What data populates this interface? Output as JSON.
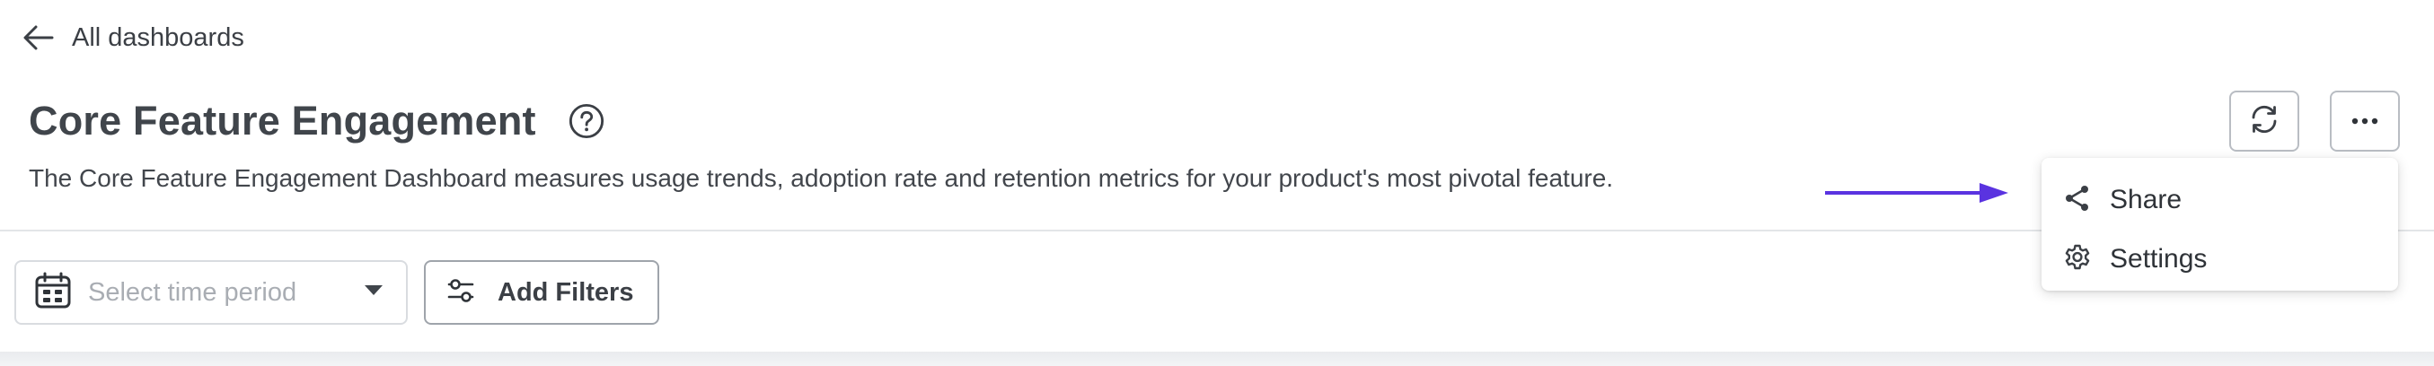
{
  "header": {
    "back_label": "All dashboards",
    "title": "Core Feature Engagement",
    "description": "The Core Feature Engagement Dashboard measures usage trends, adoption rate and retention metrics for your product's most pivotal feature."
  },
  "toolbar": {
    "refresh_icon": "refresh-icon",
    "more_icon": "more-horizontal-icon"
  },
  "more_menu": {
    "items": [
      {
        "label": "Share",
        "icon": "share-icon"
      },
      {
        "label": "Settings",
        "icon": "gear-icon"
      }
    ]
  },
  "filters": {
    "time_period_placeholder": "Select time period",
    "add_filters_label": "Add Filters"
  },
  "colors": {
    "annotation_arrow": "#5a33e0",
    "text_primary": "#40454b",
    "border": "#b9bdc3"
  }
}
